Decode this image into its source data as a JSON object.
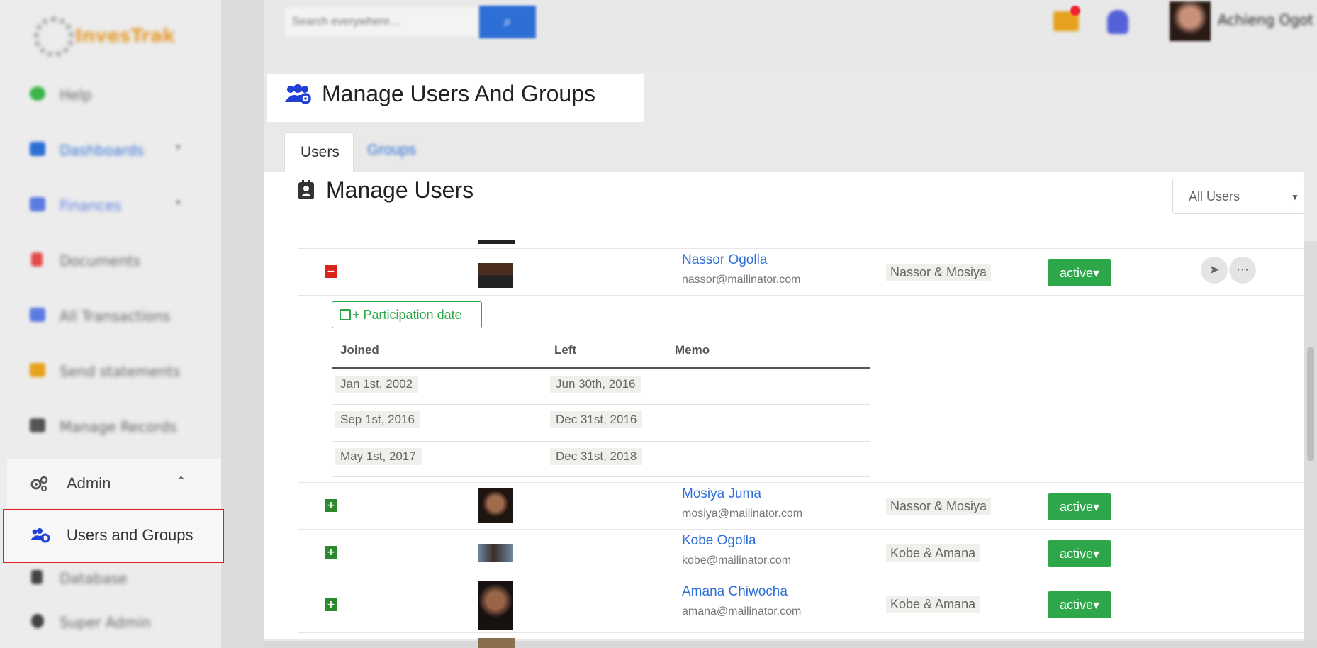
{
  "sidebar": {
    "logo_text": "InvesTrak",
    "items": [
      {
        "label": "Help",
        "icon": "help-icon",
        "color": "#3bb54a"
      },
      {
        "label": "Dashboards",
        "icon": "dashboard-icon",
        "color": "#2e6fd6"
      },
      {
        "label": "Finances",
        "icon": "finances-icon",
        "color": "#5b7be0"
      },
      {
        "label": "Documents",
        "icon": "document-icon",
        "color": "#e24a4a"
      },
      {
        "label": "All Transactions",
        "icon": "transactions-icon",
        "color": "#5b7be0"
      },
      {
        "label": "Send statements",
        "icon": "statements-icon",
        "color": "#e6a21e"
      },
      {
        "label": "Manage Records",
        "icon": "records-icon",
        "color": "#555555"
      },
      {
        "label": "Database",
        "icon": "database-icon",
        "color": "#444444"
      },
      {
        "label": "Super Admin",
        "icon": "super-admin-icon",
        "color": "#444444"
      }
    ],
    "admin_label": "Admin",
    "users_groups_label": "Users and Groups"
  },
  "topbar": {
    "search_placeholder": "Search everywhere...",
    "user_name": "Achieng Ogot"
  },
  "page": {
    "title": "Manage Users And Groups",
    "tabs": [
      "Users",
      "Groups"
    ],
    "section_title": "Manage Users",
    "filter_value": "All Users"
  },
  "users": [
    {
      "name": "Nassor Ogolla",
      "email": "nassor@mailinator.com",
      "group": "Nassor & Mosiya",
      "status": "active▾",
      "expanded": true
    },
    {
      "name": "Mosiya Juma",
      "email": "mosiya@mailinator.com",
      "group": "Nassor & Mosiya",
      "status": "active▾",
      "expanded": false
    },
    {
      "name": "Kobe Ogolla",
      "email": "kobe@mailinator.com",
      "group": "Kobe & Amana",
      "status": "active▾",
      "expanded": false
    },
    {
      "name": "Amana Chiwocha",
      "email": "amana@mailinator.com",
      "group": "Kobe & Amana",
      "status": "active▾",
      "expanded": false
    }
  ],
  "participation": {
    "button_label": "+ Participation date",
    "headers": [
      "Joined",
      "Left",
      "Memo"
    ],
    "rows": [
      {
        "joined": "Jan 1st, 2002",
        "left": "Jun 30th, 2016",
        "memo": ""
      },
      {
        "joined": "Sep 1st, 2016",
        "left": "Dec 31st, 2016",
        "memo": ""
      },
      {
        "joined": "May 1st, 2017",
        "left": "Dec 31st, 2018",
        "memo": ""
      }
    ]
  },
  "colors": {
    "accent_blue": "#2e6fd6",
    "active_green": "#2ea74a",
    "remove_red": "#d9241c",
    "add_green": "#2b8a2b",
    "highlight_red": "#e01c1c"
  }
}
